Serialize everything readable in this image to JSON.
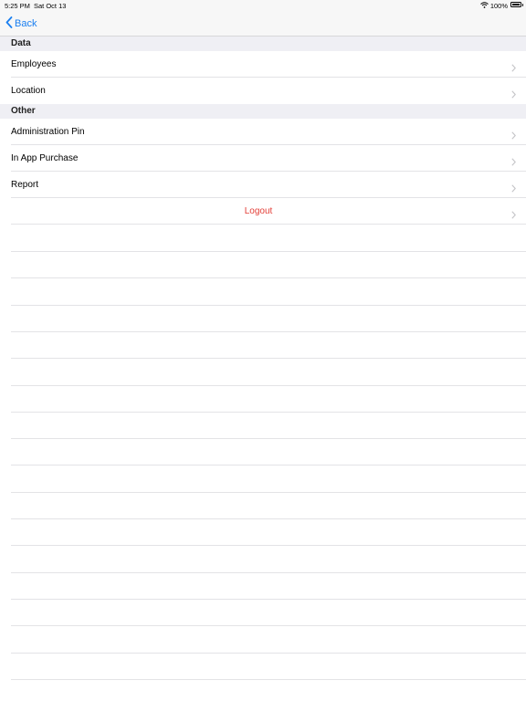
{
  "status": {
    "time": "5:25 PM",
    "date": "Sat Oct 13",
    "battery": "100%",
    "battery_level": 1.0
  },
  "nav": {
    "back_label": "Back",
    "accent_color": "#1a7ff0"
  },
  "sections": [
    {
      "header": "Data",
      "rows": [
        {
          "label": "Employees"
        },
        {
          "label": "Location"
        }
      ]
    },
    {
      "header": "Other",
      "rows": [
        {
          "label": "Administration Pin"
        },
        {
          "label": "In App Purchase"
        },
        {
          "label": "Report"
        },
        {
          "label": "Logout"
        }
      ]
    }
  ],
  "logout_color": "#e33d36",
  "icons": [
    "chevron-left-icon",
    "chevron-right-icon",
    "wifi-icon",
    "battery-icon"
  ]
}
